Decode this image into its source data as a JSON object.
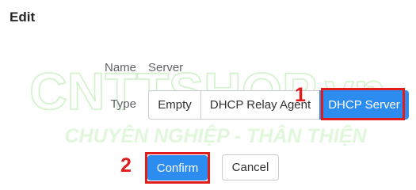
{
  "dialog": {
    "title": "Edit"
  },
  "form": {
    "name_label": "Name",
    "name_value": "Server",
    "type_label": "Type",
    "type_options": [
      "Empty",
      "DHCP Relay Agent",
      "DHCP Server"
    ],
    "type_selected": "DHCP Server"
  },
  "actions": {
    "confirm_label": "Confirm",
    "cancel_label": "Cancel"
  },
  "annotations": {
    "step_1": "1",
    "step_2": "2"
  },
  "watermark": {
    "brand": "CNTTSHOP.vn",
    "tagline": "CHUYÊN NGHIỆP - THÂN THIỆN"
  },
  "colors": {
    "accent": "#2d8cf0",
    "annotation": "#e21b1b",
    "watermark": "#c8f0c0"
  }
}
